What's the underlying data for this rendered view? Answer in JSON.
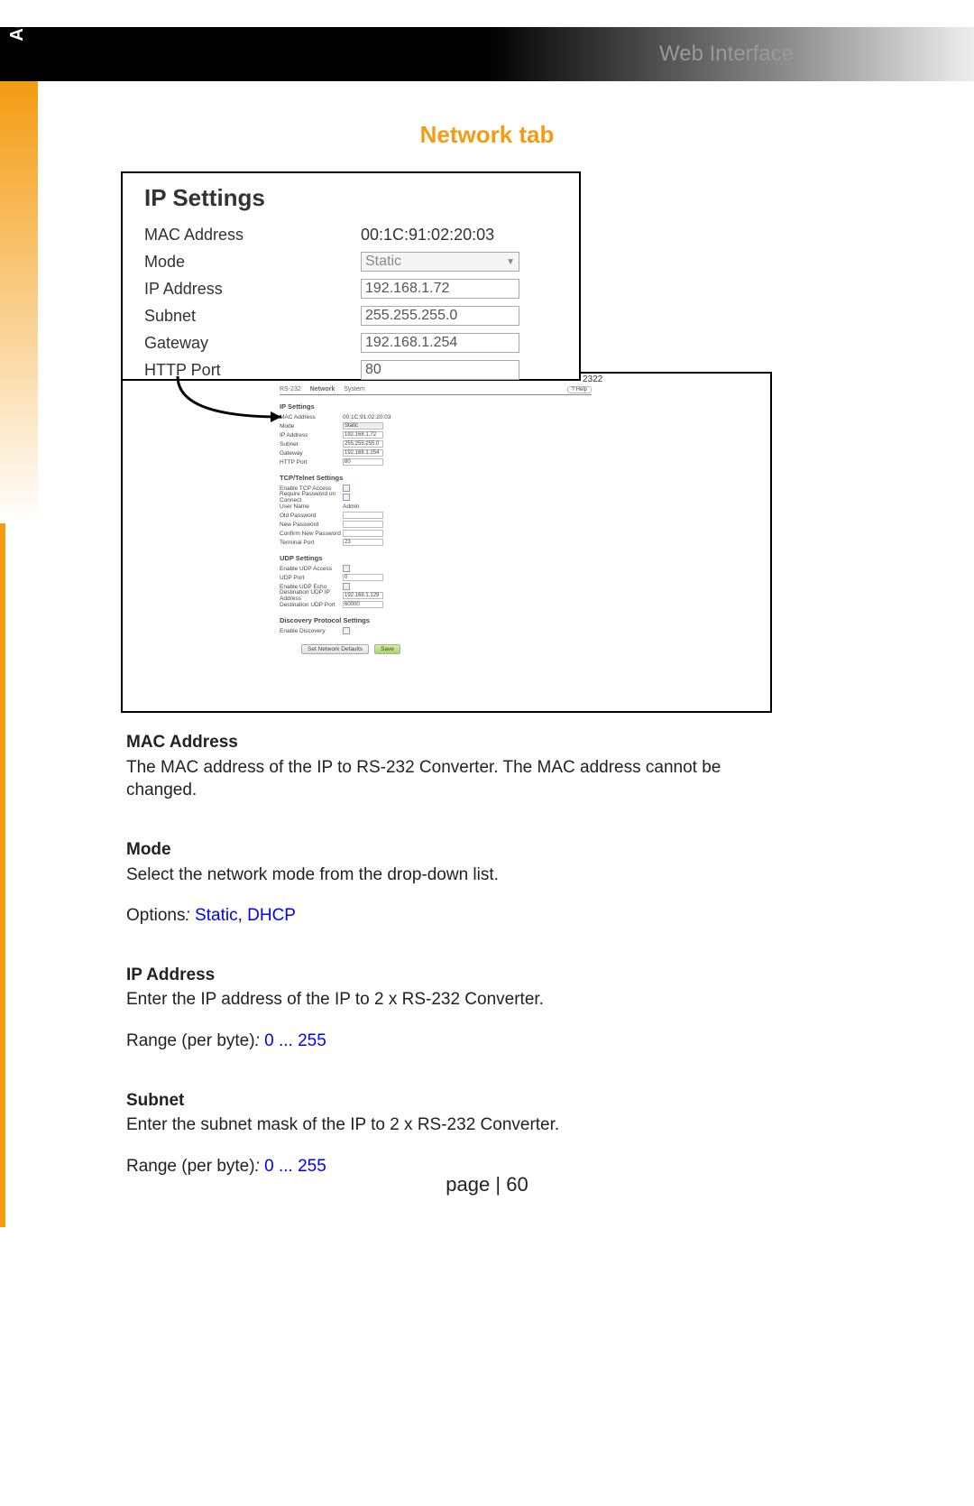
{
  "header": {
    "title": "Web Interface"
  },
  "side_tab": "Advanced Operation",
  "section_title": "Network tab",
  "zoom": {
    "heading": "IP Settings",
    "mac_label": "MAC Address",
    "mac_value": "00:1C:91:02:20:03",
    "mode_label": "Mode",
    "mode_value": "Static",
    "ip_label": "IP Address",
    "ip_value": "192.168.1.72",
    "subnet_label": "Subnet",
    "subnet_value": "255.255.255.0",
    "gateway_label": "Gateway",
    "gateway_value": "192.168.1.254",
    "http_label": "HTTP Port",
    "http_value": "80"
  },
  "code_right": "2322",
  "mini": {
    "tabs": {
      "t1": "RS-232",
      "t2": "Network",
      "t3": "System"
    },
    "help": "? Help",
    "ip_settings": {
      "title": "IP Settings",
      "mac_l": "MAC Address",
      "mac_v": "00:1C:91:02:20:03",
      "mode_l": "Mode",
      "mode_v": "Static",
      "ip_l": "IP Address",
      "ip_v": "192.168.1.72",
      "sub_l": "Subnet",
      "sub_v": "255.255.255.0",
      "gw_l": "Gateway",
      "gw_v": "192.168.1.254",
      "http_l": "HTTP Port",
      "http_v": "80"
    },
    "tcp": {
      "title": "TCP/Telnet Settings",
      "en_l": "Enable TCP Access",
      "req_l": "Require Password on Connect",
      "user_l": "User Name",
      "user_v": "Admin",
      "old_l": "Old Password",
      "new_l": "New Password",
      "conf_l": "Confirm New Password",
      "term_l": "Terminal Port",
      "term_v": "23"
    },
    "udp": {
      "title": "UDP Settings",
      "en_l": "Enable UDP Access",
      "port_l": "UDP Port",
      "port_v": "0",
      "echo_l": "Enable UDP Echo",
      "dip_l": "Destination UDP IP Address",
      "dip_v": "192.168.1.129",
      "dport_l": "Destination UDP Port",
      "dport_v": "60000"
    },
    "disc": {
      "title": "Discovery Protocol Settings",
      "en_l": "Enable Discovery"
    },
    "btn_defaults": "Set Network Defaults",
    "btn_save": "Save"
  },
  "doc": {
    "mac_title": "MAC Address",
    "mac_body": "The MAC address of the IP to RS-232 Converter.  The MAC address cannot be changed.",
    "mode_title": "Mode",
    "mode_body": "Select the network mode from the drop-down list.",
    "mode_options_pre": "Options",
    "mode_opt1": "Static",
    "mode_opt2": "DHCP",
    "ip_title": "IP Address",
    "ip_body": "Enter the IP address of the IP to 2 x RS-232 Converter.",
    "range_pre": "Range (per byte)",
    "range_val": "0 ... 255",
    "subnet_title": "Subnet",
    "subnet_body": "Enter the subnet mask of the IP to 2 x RS-232 Converter."
  },
  "footer": {
    "label": "page",
    "num": "60"
  }
}
